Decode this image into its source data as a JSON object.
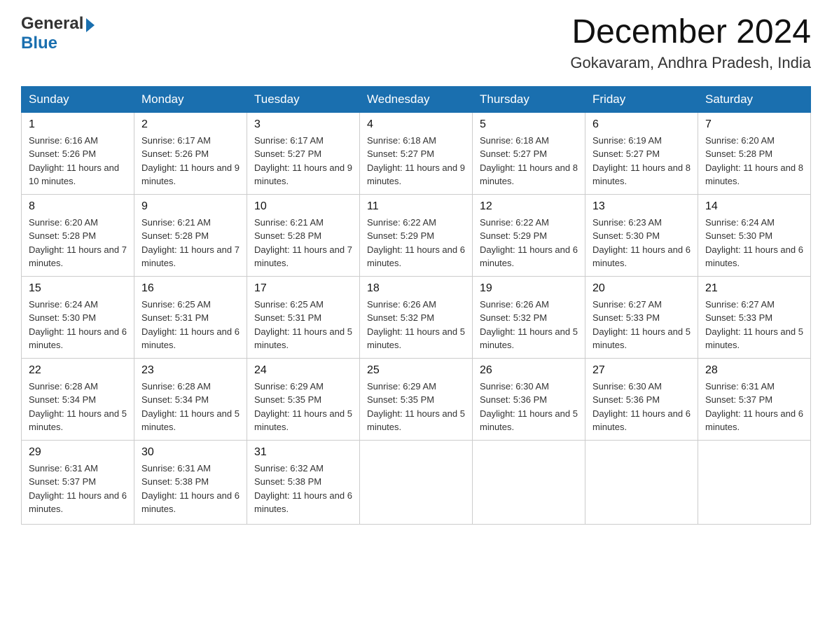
{
  "logo": {
    "text_general": "General",
    "text_blue": "Blue"
  },
  "header": {
    "title": "December 2024",
    "subtitle": "Gokavaram, Andhra Pradesh, India"
  },
  "weekdays": [
    "Sunday",
    "Monday",
    "Tuesday",
    "Wednesday",
    "Thursday",
    "Friday",
    "Saturday"
  ],
  "weeks": [
    [
      {
        "day": "1",
        "sunrise": "Sunrise: 6:16 AM",
        "sunset": "Sunset: 5:26 PM",
        "daylight": "Daylight: 11 hours and 10 minutes."
      },
      {
        "day": "2",
        "sunrise": "Sunrise: 6:17 AM",
        "sunset": "Sunset: 5:26 PM",
        "daylight": "Daylight: 11 hours and 9 minutes."
      },
      {
        "day": "3",
        "sunrise": "Sunrise: 6:17 AM",
        "sunset": "Sunset: 5:27 PM",
        "daylight": "Daylight: 11 hours and 9 minutes."
      },
      {
        "day": "4",
        "sunrise": "Sunrise: 6:18 AM",
        "sunset": "Sunset: 5:27 PM",
        "daylight": "Daylight: 11 hours and 9 minutes."
      },
      {
        "day": "5",
        "sunrise": "Sunrise: 6:18 AM",
        "sunset": "Sunset: 5:27 PM",
        "daylight": "Daylight: 11 hours and 8 minutes."
      },
      {
        "day": "6",
        "sunrise": "Sunrise: 6:19 AM",
        "sunset": "Sunset: 5:27 PM",
        "daylight": "Daylight: 11 hours and 8 minutes."
      },
      {
        "day": "7",
        "sunrise": "Sunrise: 6:20 AM",
        "sunset": "Sunset: 5:28 PM",
        "daylight": "Daylight: 11 hours and 8 minutes."
      }
    ],
    [
      {
        "day": "8",
        "sunrise": "Sunrise: 6:20 AM",
        "sunset": "Sunset: 5:28 PM",
        "daylight": "Daylight: 11 hours and 7 minutes."
      },
      {
        "day": "9",
        "sunrise": "Sunrise: 6:21 AM",
        "sunset": "Sunset: 5:28 PM",
        "daylight": "Daylight: 11 hours and 7 minutes."
      },
      {
        "day": "10",
        "sunrise": "Sunrise: 6:21 AM",
        "sunset": "Sunset: 5:28 PM",
        "daylight": "Daylight: 11 hours and 7 minutes."
      },
      {
        "day": "11",
        "sunrise": "Sunrise: 6:22 AM",
        "sunset": "Sunset: 5:29 PM",
        "daylight": "Daylight: 11 hours and 6 minutes."
      },
      {
        "day": "12",
        "sunrise": "Sunrise: 6:22 AM",
        "sunset": "Sunset: 5:29 PM",
        "daylight": "Daylight: 11 hours and 6 minutes."
      },
      {
        "day": "13",
        "sunrise": "Sunrise: 6:23 AM",
        "sunset": "Sunset: 5:30 PM",
        "daylight": "Daylight: 11 hours and 6 minutes."
      },
      {
        "day": "14",
        "sunrise": "Sunrise: 6:24 AM",
        "sunset": "Sunset: 5:30 PM",
        "daylight": "Daylight: 11 hours and 6 minutes."
      }
    ],
    [
      {
        "day": "15",
        "sunrise": "Sunrise: 6:24 AM",
        "sunset": "Sunset: 5:30 PM",
        "daylight": "Daylight: 11 hours and 6 minutes."
      },
      {
        "day": "16",
        "sunrise": "Sunrise: 6:25 AM",
        "sunset": "Sunset: 5:31 PM",
        "daylight": "Daylight: 11 hours and 6 minutes."
      },
      {
        "day": "17",
        "sunrise": "Sunrise: 6:25 AM",
        "sunset": "Sunset: 5:31 PM",
        "daylight": "Daylight: 11 hours and 5 minutes."
      },
      {
        "day": "18",
        "sunrise": "Sunrise: 6:26 AM",
        "sunset": "Sunset: 5:32 PM",
        "daylight": "Daylight: 11 hours and 5 minutes."
      },
      {
        "day": "19",
        "sunrise": "Sunrise: 6:26 AM",
        "sunset": "Sunset: 5:32 PM",
        "daylight": "Daylight: 11 hours and 5 minutes."
      },
      {
        "day": "20",
        "sunrise": "Sunrise: 6:27 AM",
        "sunset": "Sunset: 5:33 PM",
        "daylight": "Daylight: 11 hours and 5 minutes."
      },
      {
        "day": "21",
        "sunrise": "Sunrise: 6:27 AM",
        "sunset": "Sunset: 5:33 PM",
        "daylight": "Daylight: 11 hours and 5 minutes."
      }
    ],
    [
      {
        "day": "22",
        "sunrise": "Sunrise: 6:28 AM",
        "sunset": "Sunset: 5:34 PM",
        "daylight": "Daylight: 11 hours and 5 minutes."
      },
      {
        "day": "23",
        "sunrise": "Sunrise: 6:28 AM",
        "sunset": "Sunset: 5:34 PM",
        "daylight": "Daylight: 11 hours and 5 minutes."
      },
      {
        "day": "24",
        "sunrise": "Sunrise: 6:29 AM",
        "sunset": "Sunset: 5:35 PM",
        "daylight": "Daylight: 11 hours and 5 minutes."
      },
      {
        "day": "25",
        "sunrise": "Sunrise: 6:29 AM",
        "sunset": "Sunset: 5:35 PM",
        "daylight": "Daylight: 11 hours and 5 minutes."
      },
      {
        "day": "26",
        "sunrise": "Sunrise: 6:30 AM",
        "sunset": "Sunset: 5:36 PM",
        "daylight": "Daylight: 11 hours and 5 minutes."
      },
      {
        "day": "27",
        "sunrise": "Sunrise: 6:30 AM",
        "sunset": "Sunset: 5:36 PM",
        "daylight": "Daylight: 11 hours and 6 minutes."
      },
      {
        "day": "28",
        "sunrise": "Sunrise: 6:31 AM",
        "sunset": "Sunset: 5:37 PM",
        "daylight": "Daylight: 11 hours and 6 minutes."
      }
    ],
    [
      {
        "day": "29",
        "sunrise": "Sunrise: 6:31 AM",
        "sunset": "Sunset: 5:37 PM",
        "daylight": "Daylight: 11 hours and 6 minutes."
      },
      {
        "day": "30",
        "sunrise": "Sunrise: 6:31 AM",
        "sunset": "Sunset: 5:38 PM",
        "daylight": "Daylight: 11 hours and 6 minutes."
      },
      {
        "day": "31",
        "sunrise": "Sunrise: 6:32 AM",
        "sunset": "Sunset: 5:38 PM",
        "daylight": "Daylight: 11 hours and 6 minutes."
      },
      null,
      null,
      null,
      null
    ]
  ]
}
